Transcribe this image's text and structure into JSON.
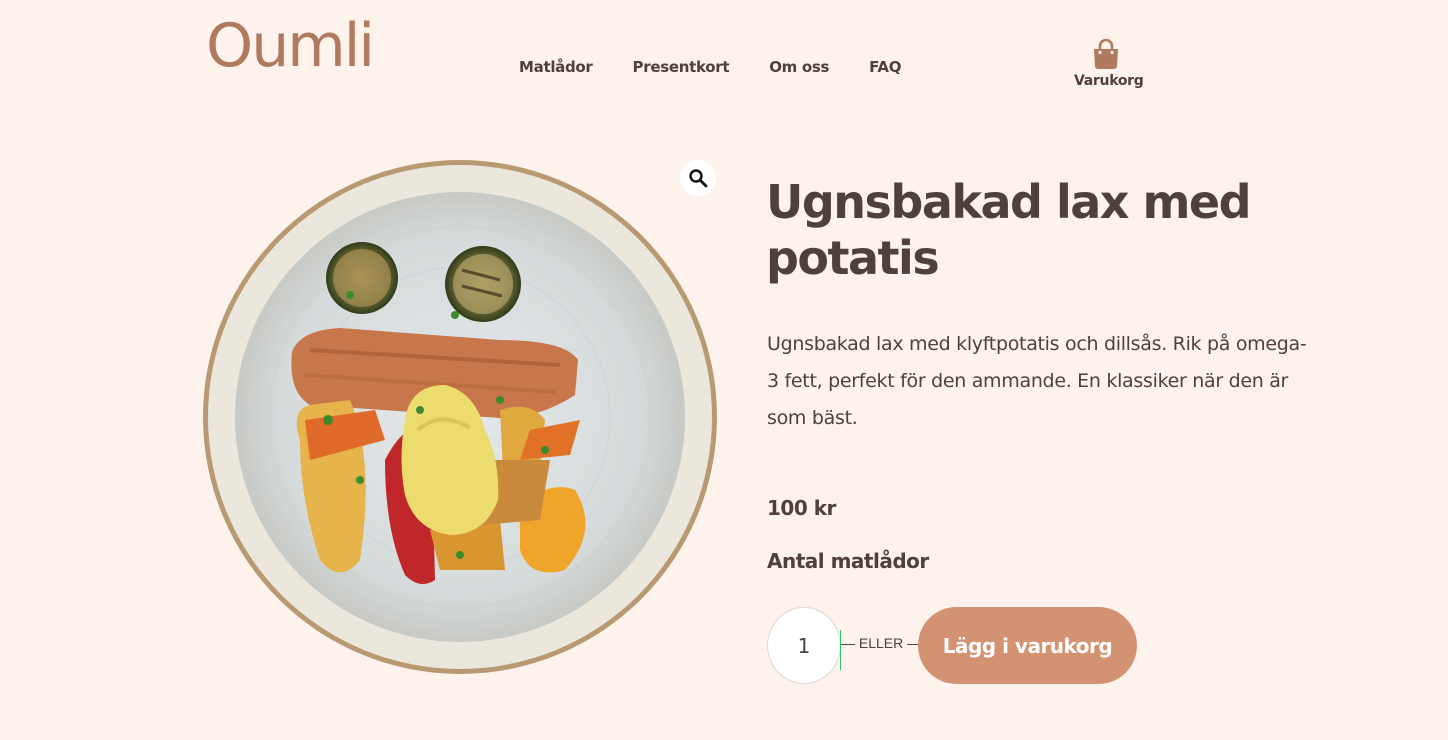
{
  "header": {
    "logo": "Oumli",
    "nav": [
      "Matlådor",
      "Presentkort",
      "Om oss",
      "FAQ"
    ],
    "cart_label": "Varukorg",
    "cart_icon": "shopping-bag-icon"
  },
  "product": {
    "image_alt": "plated-salmon-with-potatoes-and-dill-sauce",
    "zoom_icon": "magnifier-icon",
    "title": "Ugnsbakad lax med potatis",
    "description": "Ugnsbakad lax med klyftpotatis och dillsås. Rik på omega-3 fett, perfekt för den ammande. En klassiker när den är som bäst.",
    "price": "100 kr",
    "quantity_label": "Antal matlådor",
    "quantity": "1",
    "or_separator": "— ELLER —",
    "add_to_cart": "Lägg i varukorg"
  },
  "colors": {
    "background": "#fef2ec",
    "brand": "#b07a5f",
    "text": "#4f3f3d",
    "button": "#d39373"
  }
}
